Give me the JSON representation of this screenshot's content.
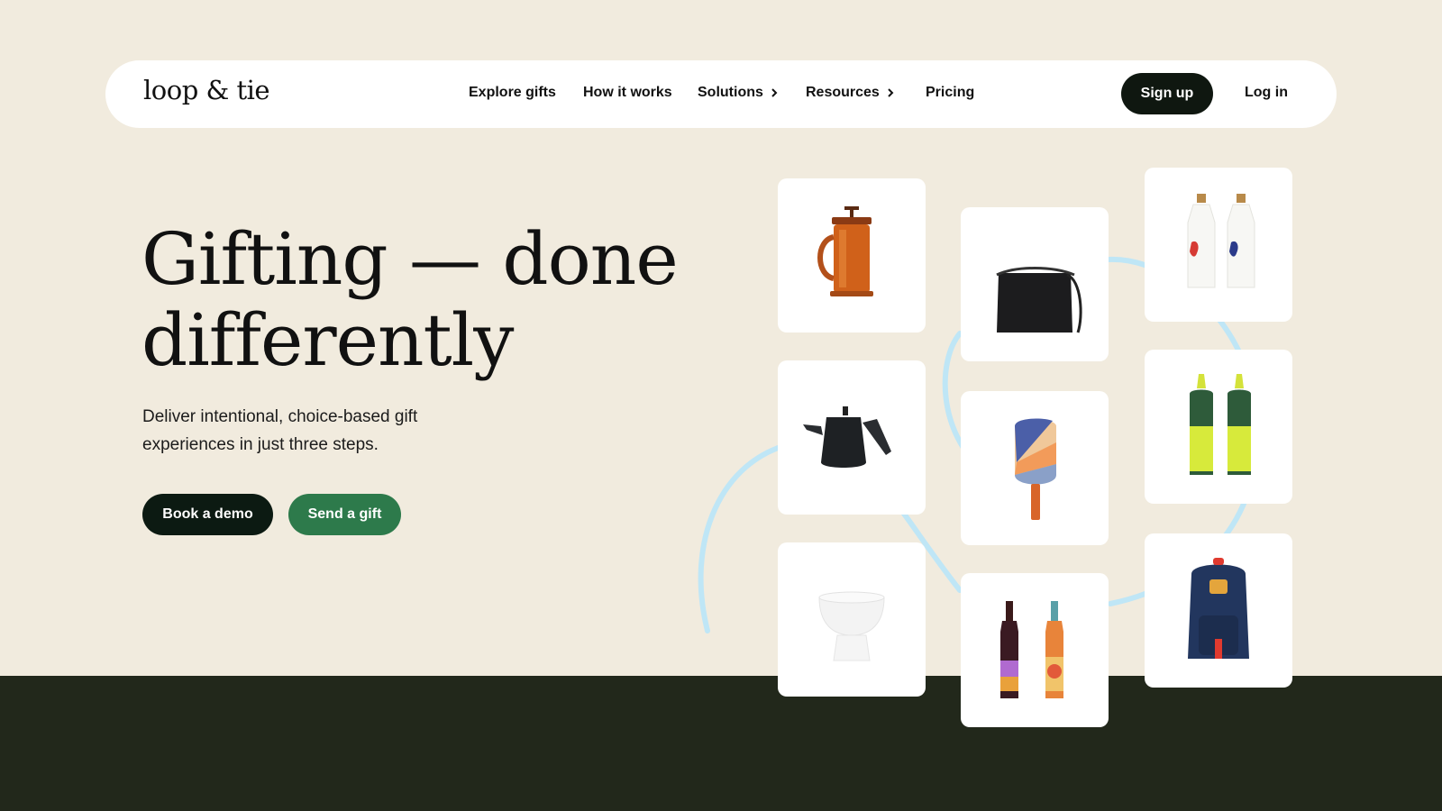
{
  "brand": {
    "logo_text": "loop & tie"
  },
  "nav": {
    "links": [
      {
        "label": "Explore gifts",
        "has_chevron": false
      },
      {
        "label": "How it works",
        "has_chevron": false
      },
      {
        "label": "Solutions",
        "has_chevron": true
      },
      {
        "label": "Resources",
        "has_chevron": true
      },
      {
        "label": "Pricing",
        "has_chevron": false
      }
    ],
    "signup_label": "Sign up",
    "login_label": "Log in"
  },
  "hero": {
    "title_line1": "Gifting — done",
    "title_line2": "differently",
    "subtitle": "Deliver intentional, choice-based gift experiences in just three steps.",
    "primary_cta": "Book a demo",
    "secondary_cta": "Send a gift"
  },
  "products": [
    {
      "name": "french-press",
      "icon": "french-press-icon"
    },
    {
      "name": "kettle",
      "icon": "kettle-icon"
    },
    {
      "name": "ceramic-bowl",
      "icon": "bowl-icon"
    },
    {
      "name": "crossbody-bag",
      "icon": "bag-icon"
    },
    {
      "name": "pickleball-paddle",
      "icon": "paddle-icon"
    },
    {
      "name": "wine-bottles",
      "icon": "wine-icon"
    },
    {
      "name": "olive-oil-bottles-white",
      "icon": "oil-bottle-icon"
    },
    {
      "name": "olive-oil-bottles-green",
      "icon": "squeeze-bottle-icon"
    },
    {
      "name": "backpack",
      "icon": "backpack-icon"
    }
  ],
  "colors": {
    "background": "#f1ebde",
    "footer_band": "#22281b",
    "primary_button": "#0c1a12",
    "secondary_button": "#2d7a4b",
    "arc": "#bfe6f6"
  }
}
